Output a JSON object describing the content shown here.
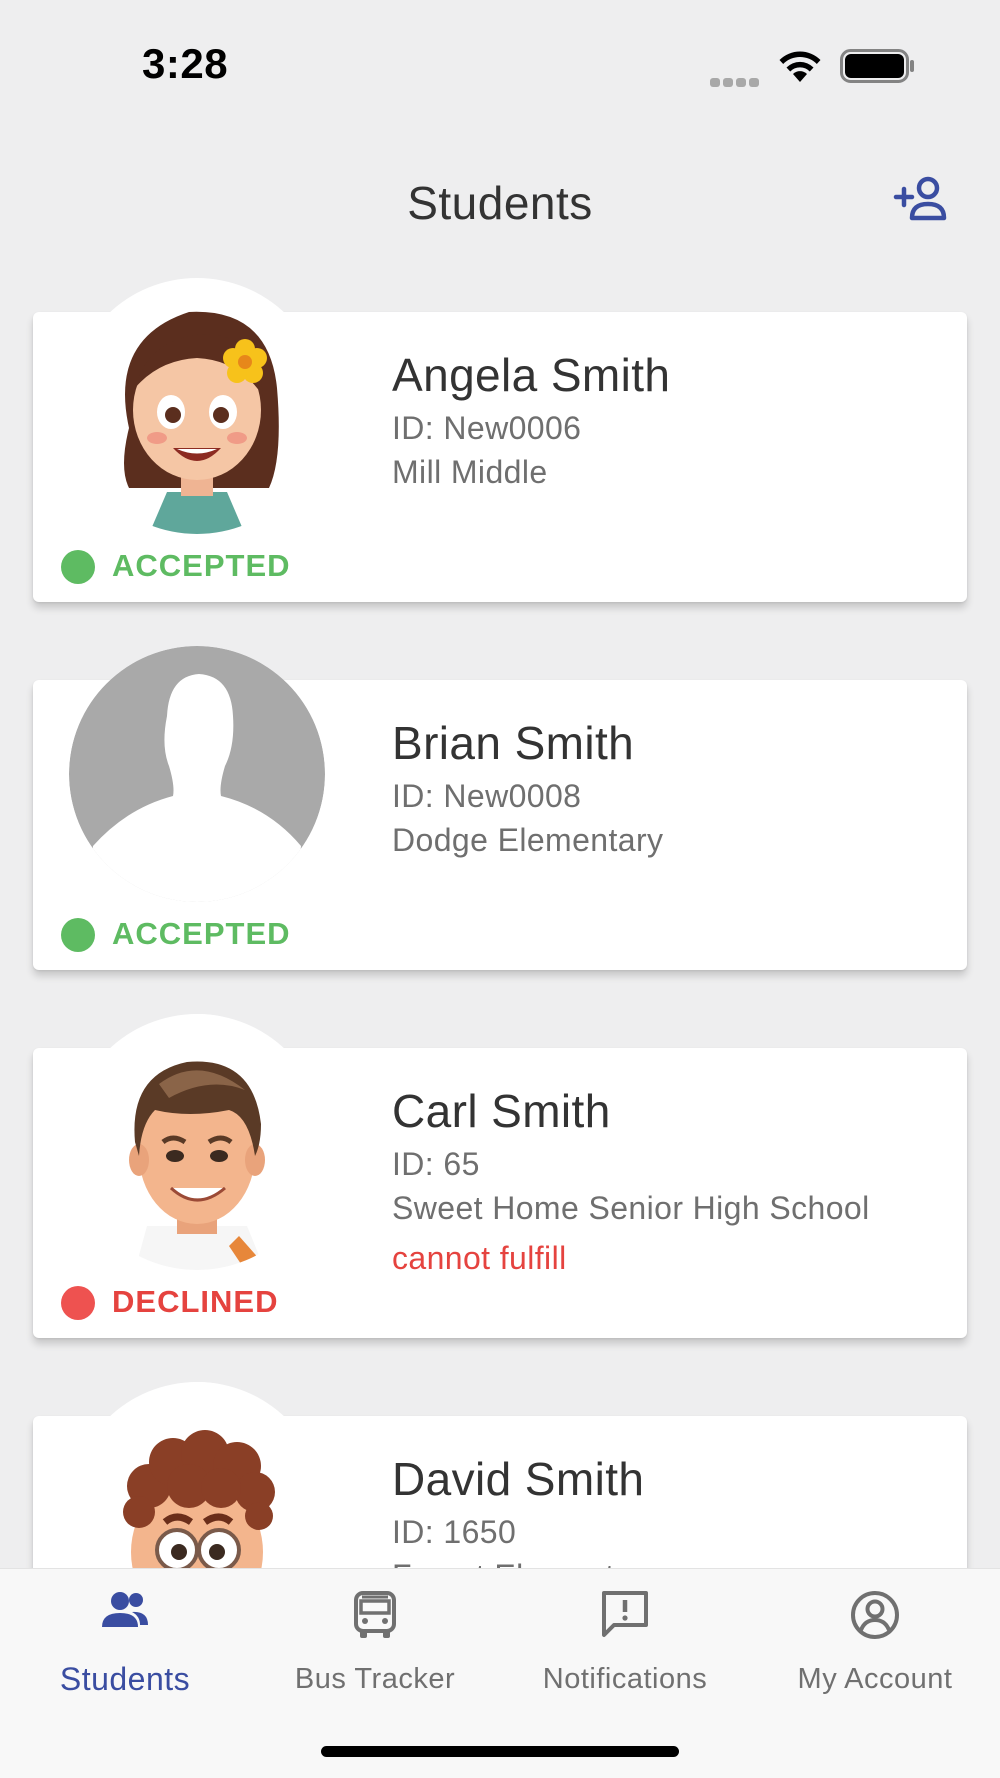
{
  "status_bar": {
    "time": "3:28"
  },
  "header": {
    "title": "Students"
  },
  "students": [
    {
      "name": "Angela Smith",
      "id": "ID: New0006",
      "school": "Mill Middle",
      "note": "",
      "status": "ACCEPTED"
    },
    {
      "name": "Brian Smith",
      "id": "ID: New0008",
      "school": "Dodge Elementary",
      "note": "",
      "status": "ACCEPTED"
    },
    {
      "name": "Carl Smith",
      "id": "ID: 65",
      "school": "Sweet Home Senior High School",
      "note": "cannot fulfill",
      "status": "DECLINED"
    },
    {
      "name": "David Smith",
      "id": "ID: 1650",
      "school": "Forest Elementary",
      "note": "",
      "status": ""
    }
  ],
  "tabs": [
    {
      "label": "Students",
      "icon": "people-icon",
      "active": true
    },
    {
      "label": "Bus Tracker",
      "icon": "bus-icon",
      "active": false
    },
    {
      "label": "Notifications",
      "icon": "alert-message-icon",
      "active": false
    },
    {
      "label": "My Account",
      "icon": "account-circle-icon",
      "active": false
    }
  ],
  "colors": {
    "accent": "#3A4DA1",
    "accepted": "#5EBB62",
    "declined": "#E5433F",
    "background": "#EEEEEF"
  }
}
